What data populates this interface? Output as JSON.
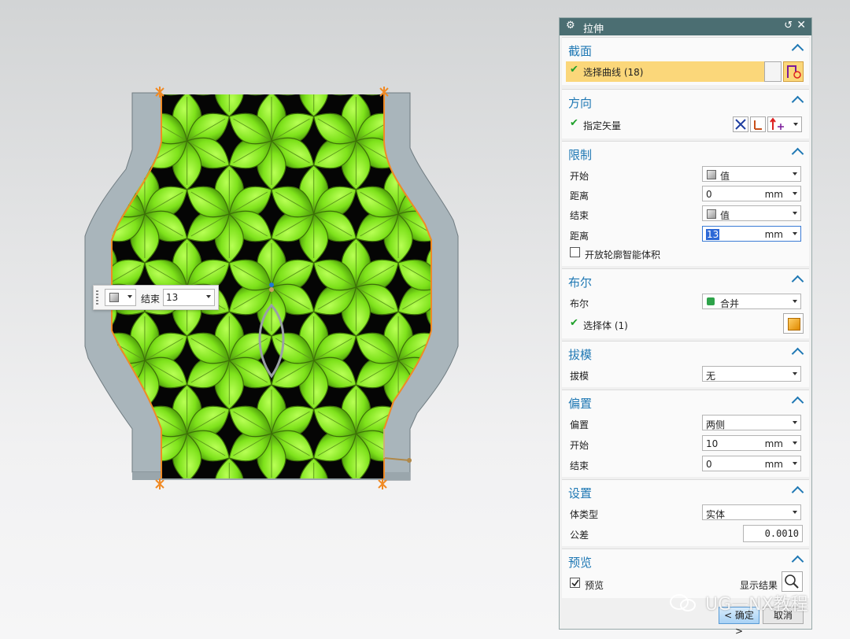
{
  "minitoolbar": {
    "label": "结束",
    "value": "13",
    "cube_icon": "cube-icon"
  },
  "dialog": {
    "title": "拉伸",
    "sections": {
      "section": {
        "title": "截面",
        "select_curve": "选择曲线 (18)"
      },
      "direction": {
        "title": "方向",
        "specify_vector": "指定矢量"
      },
      "limits": {
        "title": "限制",
        "start_label": "开始",
        "start_type": "值",
        "distance_label": "距离",
        "start_distance": "0",
        "unit": "mm",
        "end_label": "结束",
        "end_type": "值",
        "end_distance": "13",
        "open_profile": "开放轮廓智能体积"
      },
      "boolean": {
        "title": "布尔",
        "boolean_label": "布尔",
        "boolean_value": "合并",
        "select_body": "选择体 (1)"
      },
      "draft": {
        "title": "拔模",
        "draft_label": "拔模",
        "draft_value": "无"
      },
      "offset": {
        "title": "偏置",
        "offset_label": "偏置",
        "offset_value": "两侧",
        "start_label": "开始",
        "start_value": "10",
        "end_label": "结束",
        "end_value": "0"
      },
      "settings": {
        "title": "设置",
        "body_type_label": "体类型",
        "body_type_value": "实体",
        "tolerance_label": "公差",
        "tolerance_value": "0.0010"
      },
      "preview": {
        "title": "预览",
        "preview_label": "预览",
        "show_result": "显示结果"
      }
    },
    "ok_label": "< 确定 >",
    "cancel_label": "取消"
  },
  "watermark": "UG—NX教程",
  "colors": {
    "title_bar": "#4b6e72",
    "section_title": "#1f78b4",
    "highlight_row": "#fbd77a",
    "leaf_green": "#7ee21b",
    "frame_gray": "#a9b5bb",
    "orange_edge": "#f08a24"
  }
}
